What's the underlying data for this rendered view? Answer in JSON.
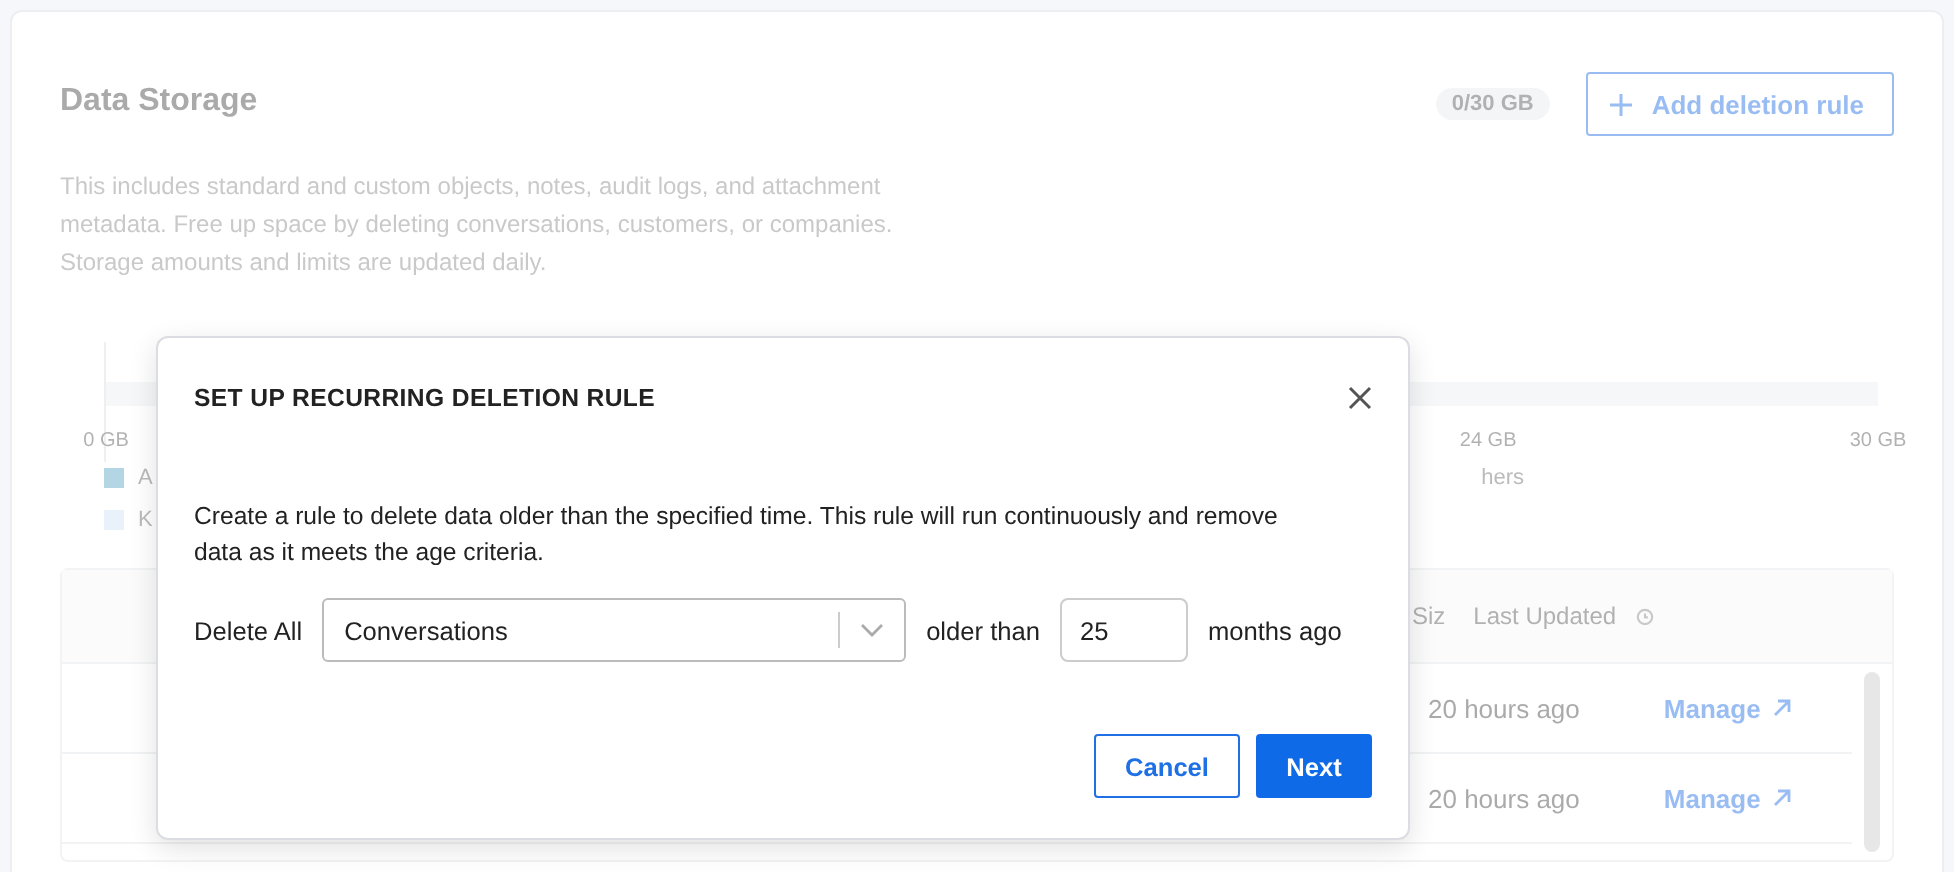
{
  "page": {
    "title": "Data Storage",
    "usage_badge": "0/30 GB",
    "add_button": "Add deletion rule",
    "description": "This includes standard and custom objects, notes, audit logs, and attachment metadata. Free up space by deleting conversations, customers, or companies. Storage amounts and limits are updated daily."
  },
  "axis_labels": [
    "0 GB",
    "24 GB",
    "30 GB"
  ],
  "legend": [
    {
      "label": "A",
      "color": "#b4d5e3"
    },
    {
      "label": "K",
      "color": "#e9f2fb"
    }
  ],
  "legend_right": "hers",
  "table": {
    "columns": [
      "Siz",
      "Last Updated"
    ],
    "rows": [
      {
        "updated": "20 hours ago",
        "action": "Manage"
      },
      {
        "updated": "20 hours ago",
        "action": "Manage"
      }
    ]
  },
  "modal": {
    "title": "SET UP RECURRING DELETION RULE",
    "body": "Create a rule to delete data older than the specified time. This rule will run continuously and remove data as it meets the age criteria.",
    "prefix": "Delete All",
    "select_value": "Conversations",
    "middle": "older than",
    "amount": "25",
    "suffix": "months ago",
    "buttons": [
      {
        "label": "Cancel",
        "kind": "secondary"
      },
      {
        "label": "Next",
        "kind": "primary"
      }
    ]
  }
}
